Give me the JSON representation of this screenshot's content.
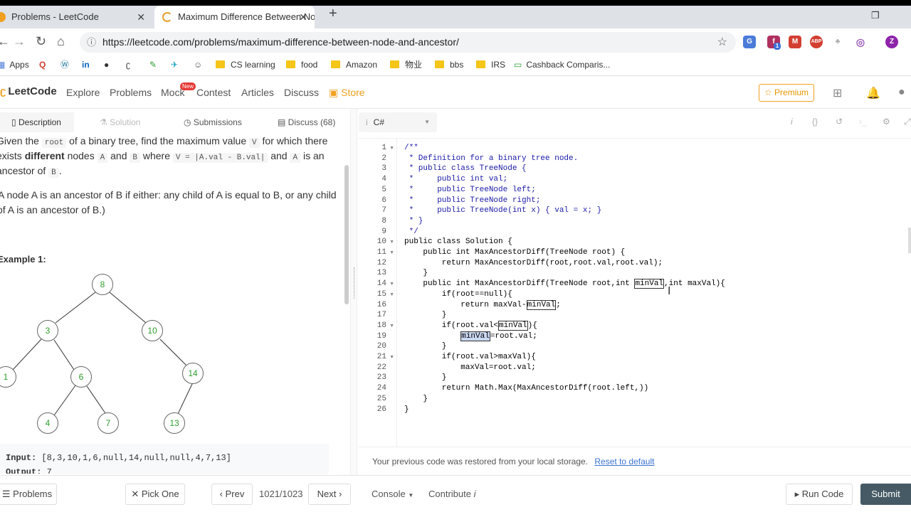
{
  "browser": {
    "tabs": [
      {
        "title": "Problems - LeetCode"
      },
      {
        "title": "Maximum Difference Between No"
      }
    ],
    "url": "https://leetcode.com/problems/maximum-difference-between-node-and-ancestor/",
    "bookmarks": [
      "Apps",
      "CS learning",
      "food",
      "Amazon",
      "物业",
      "bbs",
      "IRS",
      "Cashback Comparis..."
    ],
    "extensions": [
      "translate-icon",
      "facebook-icon",
      "gmail-icon",
      "adblock-icon",
      "extension-icon",
      "tracker-icon"
    ],
    "ext_badge": "1",
    "profile_initial": "Z"
  },
  "nav": {
    "logo": "LeetCode",
    "links": [
      "Explore",
      "Problems",
      "Mock",
      "Contest",
      "Articles",
      "Discuss",
      "Store"
    ],
    "new_badge": "New",
    "premium": "Premium"
  },
  "left_tabs": [
    "Description",
    "Solution",
    "Submissions",
    "Discuss (68)"
  ],
  "description": {
    "p1a": "Given the",
    "root": "root",
    "p1b": "of a binary tree, find the maximum value",
    "V": "V",
    "p1c": "for which there",
    "p2a": "exists",
    "different": "different",
    "p2b": "nodes",
    "A": "A",
    "and": "and",
    "B": "B",
    "where": "where",
    "formula": "V = |A.val - B.val|",
    "p2c": "and",
    "p2d": "is an",
    "p3a": "ancestor of",
    "p3b": ".",
    "p4": "A node A is an ancestor of B if either: any child of A is equal to B, or any child",
    "p5": "of A is an ancestor of B.)",
    "example_title": "Example 1:",
    "input_label": "Input:",
    "input_value": "[8,3,10,1,6,null,14,null,null,4,7,13]",
    "output_label": "Output:",
    "output_value": "7"
  },
  "tree": {
    "nodes": [
      "8",
      "3",
      "10",
      "1",
      "6",
      "14",
      "4",
      "7",
      "13"
    ]
  },
  "editor": {
    "language": "C#",
    "lines": [
      "/**",
      " * Definition for a binary tree node.",
      " * public class TreeNode {",
      " *     public int val;",
      " *     public TreeNode left;",
      " *     public TreeNode right;",
      " *     public TreeNode(int x) { val = x; }",
      " * }",
      " */",
      "public class Solution {",
      "    public int MaxAncestorDiff(TreeNode root) {",
      "        return MaxAncestorDiff(root,root.val,root.val);",
      "    }",
      "    public int MaxAncestorDiff(TreeNode root,int minVal,int maxVal){",
      "        if(root==null){",
      "            return maxVal-minVal;",
      "        }",
      "        if(root.val<minVal){",
      "            minVal=root.val;",
      "        }",
      "        if(root.val>maxVal){",
      "            maxVal=root.val;",
      "        }",
      "        return Math.Max(MaxAncestorDiff(root.left,))",
      "    }",
      "}"
    ],
    "status_msg": "Your previous code was restored from your local storage.",
    "reset_link": "Reset to default"
  },
  "bottom": {
    "problems": "Problems",
    "pick_one": "Pick One",
    "prev": "Prev",
    "counter": "1021/1023",
    "next": "Next",
    "console": "Console",
    "contribute": "Contribute",
    "run_code": "Run Code",
    "submit": "Submit"
  }
}
